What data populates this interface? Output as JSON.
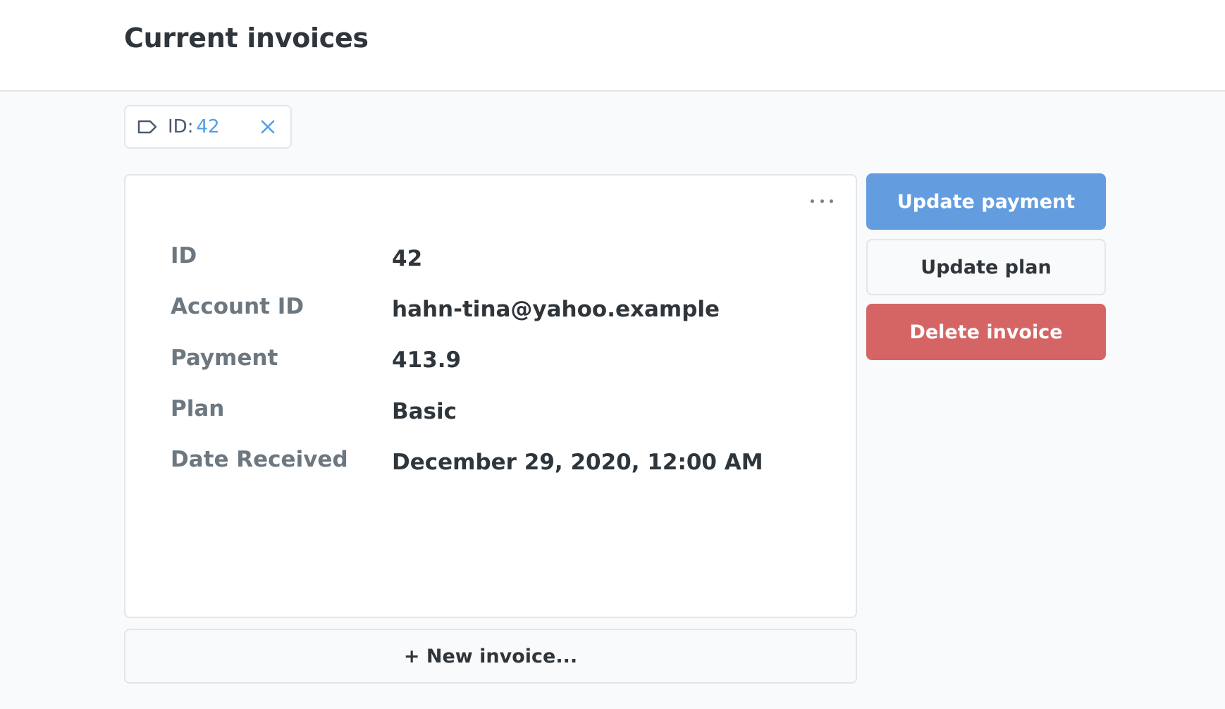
{
  "header": {
    "title": "Current invoices"
  },
  "filter": {
    "label": "ID:",
    "value": "42",
    "icon": "tag-icon",
    "close_icon": "close-icon"
  },
  "record": {
    "menu_icon": "more-horizontal-icon",
    "fields": [
      {
        "label": "ID",
        "value": "42"
      },
      {
        "label": "Account ID",
        "value": "hahn-tina@yahoo.example"
      },
      {
        "label": "Payment",
        "value": "413.9"
      },
      {
        "label": "Plan",
        "value": "Basic"
      },
      {
        "label": "Date Received",
        "value": "December 29, 2020, 12:00 AM"
      }
    ]
  },
  "actions": {
    "update_payment": "Update payment",
    "update_plan": "Update plan",
    "delete_invoice": "Delete invoice"
  },
  "footer": {
    "new_invoice": "+ New invoice..."
  },
  "colors": {
    "primary": "#649ddf",
    "danger": "#d56564",
    "accent_link": "#509ee3",
    "text_dark": "#2e353b",
    "text_muted": "#6c7780",
    "border": "#e3e5e8",
    "background": "#f9fafb"
  }
}
